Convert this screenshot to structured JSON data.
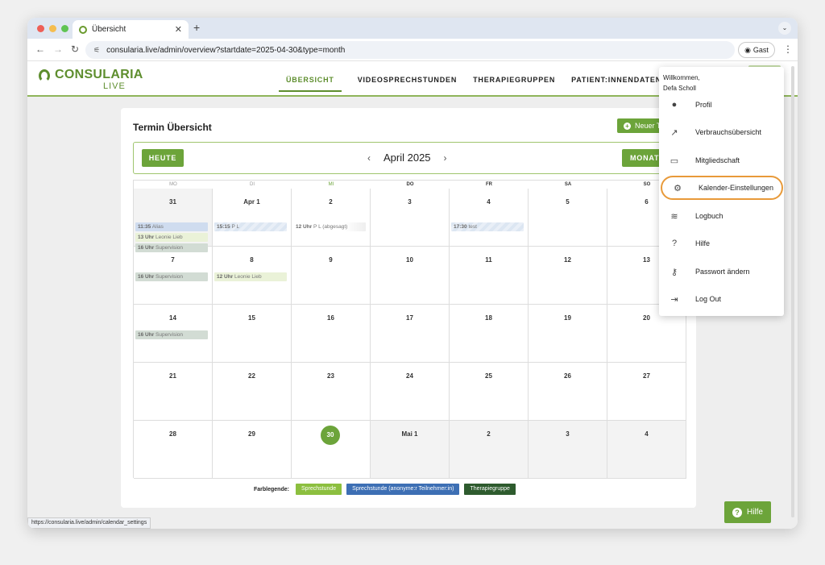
{
  "browser": {
    "tab_title": "Übersicht",
    "url": "consularia.live/admin/overview?startdate=2025-04-30&type=month",
    "guest_label": "Gast",
    "status_url": "https://consularia.live/admin/calendar_settings"
  },
  "app": {
    "brand": "CONSULARIA",
    "brand_sub": "LIVE",
    "nav": [
      "ÜBERSICHT",
      "VIDEOSPRECHSTUNDEN",
      "THERAPIEGRUPPEN",
      "PATIENT:INNENDATEN"
    ],
    "accent_color": "#6ca43a"
  },
  "card": {
    "title": "Termin Übersicht",
    "new_button": "Neuer T",
    "today_button": "HEUTE",
    "month_label": "April 2025",
    "view_button": "MONAT"
  },
  "calendar": {
    "day_headers": [
      "MO",
      "DI",
      "MI",
      "DO",
      "FR",
      "SA",
      "SO"
    ],
    "weeks": [
      [
        "31",
        "Apr 1",
        "2",
        "3",
        "4",
        "5",
        "6"
      ],
      [
        "7",
        "8",
        "9",
        "10",
        "11",
        "12",
        "13"
      ],
      [
        "14",
        "15",
        "16",
        "17",
        "18",
        "19",
        "20"
      ],
      [
        "21",
        "22",
        "23",
        "24",
        "25",
        "26",
        "27"
      ],
      [
        "28",
        "29",
        "30",
        "Mai 1",
        "2",
        "3",
        "4"
      ]
    ],
    "events": {
      "w0d0": [
        {
          "time": "11:35",
          "text": "Alias",
          "style": "blue"
        },
        {
          "time": "13 Uhr",
          "text": "Leonie Lieb",
          "style": "lgreen"
        },
        {
          "time": "16 Uhr",
          "text": "Supervision",
          "style": "dgreen"
        }
      ],
      "w0d1": [
        {
          "time": "15:15",
          "text": "P L",
          "style": "stripe"
        }
      ],
      "w0d2": [
        {
          "time": "12 Uhr",
          "text": "P L (abgesagt)",
          "style": "plain"
        }
      ],
      "w0d4": [
        {
          "time": "17:30",
          "text": "test",
          "style": "stripe"
        }
      ],
      "w1d0": [
        {
          "time": "16 Uhr",
          "text": "Supervision",
          "style": "dgreen"
        }
      ],
      "w1d1": [
        {
          "time": "12 Uhr",
          "text": "Leonie Lieb",
          "style": "lgreen"
        }
      ],
      "w2d0": [
        {
          "time": "16 Uhr",
          "text": "Supervision",
          "style": "dgreen"
        }
      ]
    }
  },
  "legend": {
    "label": "Farblegende:",
    "items": [
      {
        "text": "Sprechstunde",
        "color": "#8cbf3f"
      },
      {
        "text": "Sprechstunde (anonyme:r Teilnehmer:in)",
        "color": "#3d6fb4"
      },
      {
        "text": "Therapiegruppe",
        "color": "#2e5b2e"
      }
    ]
  },
  "dropdown": {
    "welcome": "Willkommen,",
    "user": "Defa Scholl",
    "items": [
      {
        "label": "Profil",
        "icon": "person-icon"
      },
      {
        "label": "Verbrauchsübersicht",
        "icon": "trending-icon"
      },
      {
        "label": "Mitgliedschaft",
        "icon": "folder-account-icon"
      },
      {
        "label": "Kalender-Einstellungen",
        "icon": "gear-icon"
      },
      {
        "label": "Logbuch",
        "icon": "database-icon"
      },
      {
        "label": "Hilfe",
        "icon": "question-icon"
      },
      {
        "label": "Passwort ändern",
        "icon": "key-icon"
      },
      {
        "label": "Log Out",
        "icon": "logout-icon"
      }
    ]
  },
  "help_button": "Hilfe"
}
